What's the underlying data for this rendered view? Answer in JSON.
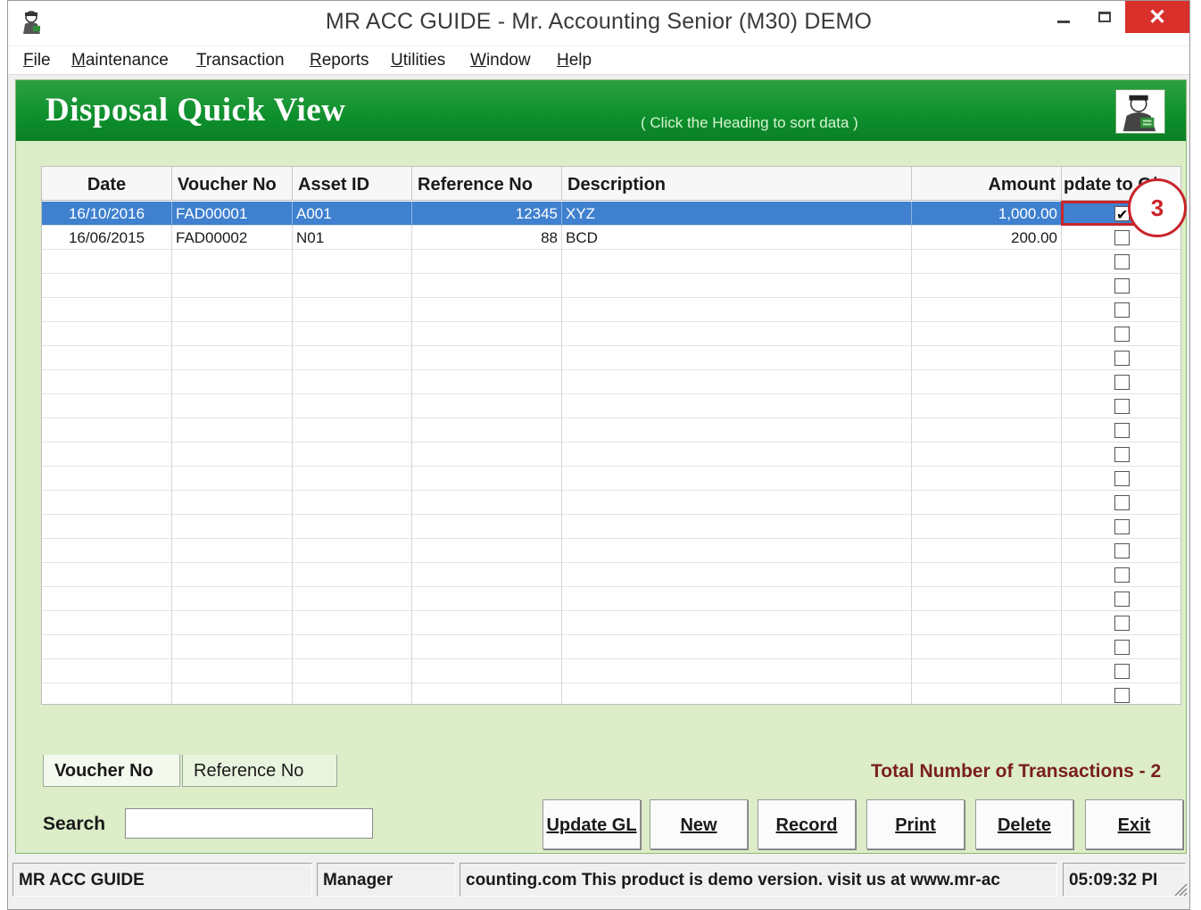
{
  "window": {
    "title": "MR ACC GUIDE - Mr. Accounting Senior (M30) DEMO",
    "controls": {
      "minimize": "—",
      "maximize": "☐",
      "close": "✕"
    }
  },
  "menu": [
    {
      "label": "File",
      "key": "F",
      "rest": "ile"
    },
    {
      "label": "Maintenance",
      "key": "M",
      "rest": "aintenance"
    },
    {
      "label": "Transaction",
      "key": "T",
      "rest": "ransaction"
    },
    {
      "label": "Reports",
      "key": "R",
      "rest": "eports"
    },
    {
      "label": "Utilities",
      "key": "U",
      "rest": "tilities"
    },
    {
      "label": "Window",
      "key": "W",
      "rest": "indow"
    },
    {
      "label": "Help",
      "key": "H",
      "rest": "elp"
    }
  ],
  "header": {
    "title": "Disposal Quick View",
    "hint": "( Click the Heading to sort data )"
  },
  "grid": {
    "columns": [
      "Date",
      "Voucher No",
      "Asset ID",
      "Reference No",
      "Description",
      "Amount",
      "pdate to G/"
    ],
    "rows": [
      {
        "date": "16/10/2016",
        "voucher": "FAD00001",
        "asset": "A001",
        "ref": "12345",
        "desc": "XYZ",
        "amount": "1,000.00",
        "update": true,
        "selected": true
      },
      {
        "date": "16/06/2015",
        "voucher": "FAD00002",
        "asset": "N01",
        "ref": "88",
        "desc": "BCD",
        "amount": "200.00",
        "update": false,
        "selected": false
      }
    ],
    "empty_rows": 20
  },
  "callout": {
    "number": "3",
    "color": "#c9252b"
  },
  "tabs": [
    {
      "label": "Voucher No",
      "active": true
    },
    {
      "label": "Reference No",
      "active": false
    }
  ],
  "total_text": "Total Number of Transactions - 2",
  "search": {
    "label": "Search",
    "value": ""
  },
  "buttons": [
    {
      "label": "Update GL",
      "key": "U"
    },
    {
      "label": "New",
      "key": "N"
    },
    {
      "label": "Record",
      "key": "R"
    },
    {
      "label": "Print",
      "key": "P"
    },
    {
      "label": "Delete",
      "key": "D"
    },
    {
      "label": "Exit",
      "key": "E"
    }
  ],
  "status": {
    "app": "MR ACC GUIDE",
    "user": "Manager",
    "message": "counting.com This product is demo version.  visit us at www.mr-ac",
    "time": "05:09:32 PI"
  },
  "colors": {
    "header_green": "#0d8f2c",
    "content_bg": "#dcedc8",
    "selection": "#3f80cf",
    "total_text": "#7a1e1e"
  }
}
